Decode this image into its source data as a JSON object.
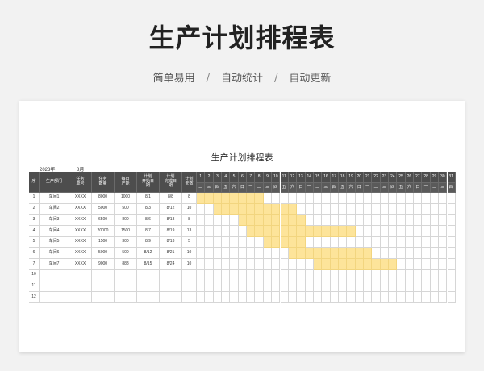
{
  "hero": {
    "title": "生产计划排程表",
    "tags": [
      "简单易用",
      "自动统计",
      "自动更新"
    ],
    "separator": "/"
  },
  "sheet": {
    "title": "生产计划排程表",
    "year": "2023年",
    "month": "8月",
    "headers": [
      "序",
      "生产部门",
      "任务\n单号",
      "任务\n数量",
      "每日\n产能",
      "计划\n开始日\n期",
      "计划\n完成日\n期",
      "计划\n天数"
    ],
    "days": [
      "1",
      "2",
      "3",
      "4",
      "5",
      "6",
      "7",
      "8",
      "9",
      "10",
      "11",
      "12",
      "13",
      "14",
      "15",
      "16",
      "17",
      "18",
      "19",
      "20",
      "21",
      "22",
      "23",
      "24",
      "25",
      "26",
      "27",
      "28",
      "29",
      "30",
      "31"
    ],
    "weekdays": [
      "二",
      "三",
      "四",
      "五",
      "六",
      "日",
      "一",
      "二",
      "三",
      "四",
      "五",
      "六",
      "日",
      "一",
      "二",
      "三",
      "四",
      "五",
      "六",
      "日",
      "一",
      "二",
      "三",
      "四",
      "五",
      "六",
      "日",
      "一",
      "二",
      "三",
      "四"
    ],
    "rows": [
      {
        "no": "1",
        "dept": "车间1",
        "order": "XXXX",
        "qty": "8000",
        "cap": "1000",
        "start": "8/1",
        "end": "8/8",
        "days": "8",
        "bar": [
          1,
          8
        ]
      },
      {
        "no": "2",
        "dept": "车间2",
        "order": "XXXX",
        "qty": "5000",
        "cap": "500",
        "start": "8/3",
        "end": "8/12",
        "days": "10",
        "bar": [
          3,
          12
        ]
      },
      {
        "no": "3",
        "dept": "车间3",
        "order": "XXXX",
        "qty": "6500",
        "cap": "800",
        "start": "8/6",
        "end": "8/13",
        "days": "8",
        "bar": [
          6,
          13
        ]
      },
      {
        "no": "4",
        "dept": "车间4",
        "order": "XXXX",
        "qty": "20000",
        "cap": "1500",
        "start": "8/7",
        "end": "8/19",
        "days": "13",
        "bar": [
          7,
          19
        ]
      },
      {
        "no": "5",
        "dept": "车间5",
        "order": "XXXX",
        "qty": "1500",
        "cap": "300",
        "start": "8/9",
        "end": "8/13",
        "days": "5",
        "bar": [
          9,
          13
        ]
      },
      {
        "no": "6",
        "dept": "车间6",
        "order": "XXXX",
        "qty": "5000",
        "cap": "500",
        "start": "8/12",
        "end": "8/21",
        "days": "10",
        "bar": [
          12,
          21
        ]
      },
      {
        "no": "7",
        "dept": "车间7",
        "order": "XXXX",
        "qty": "9000",
        "cap": "888",
        "start": "8/15",
        "end": "8/24",
        "days": "10",
        "bar": [
          15,
          24
        ]
      },
      {
        "no": "10"
      },
      {
        "no": "11"
      },
      {
        "no": "12"
      }
    ]
  }
}
